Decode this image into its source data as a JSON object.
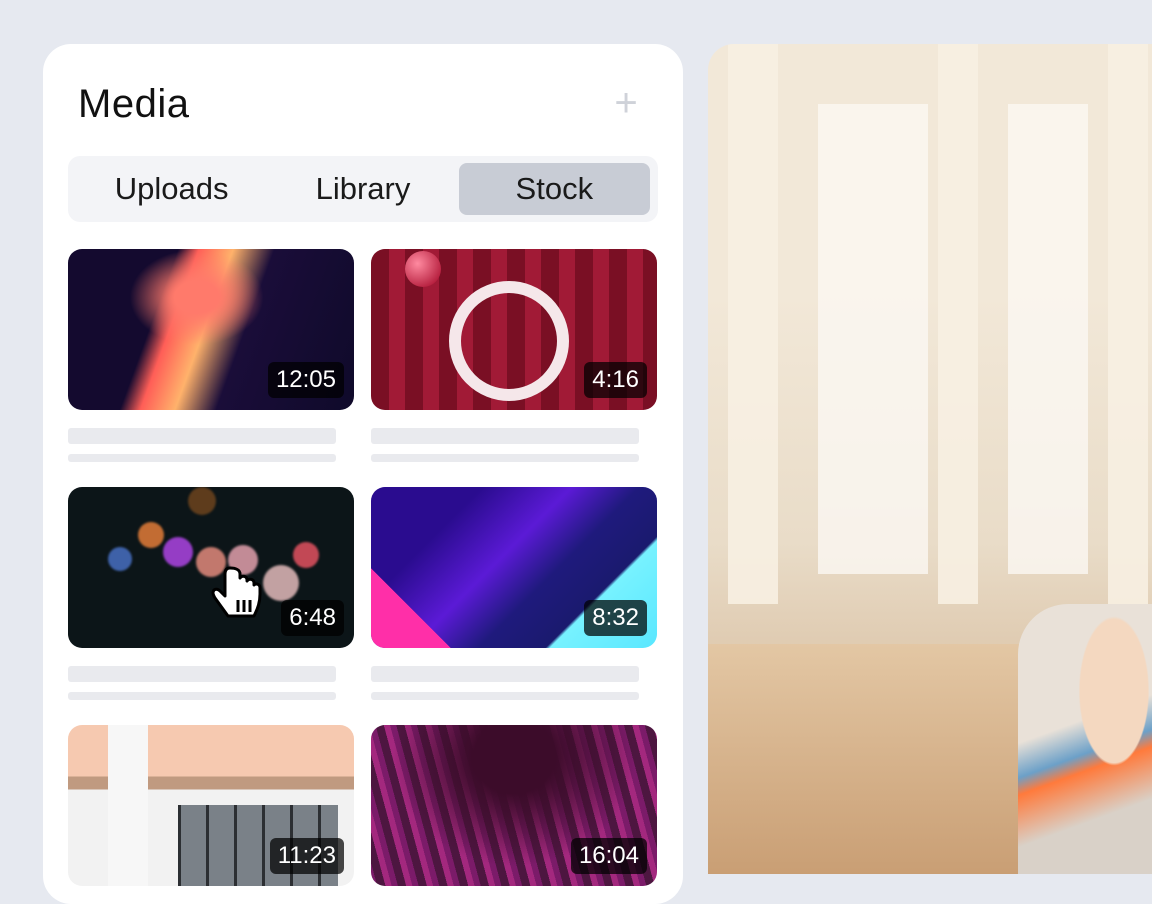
{
  "panel": {
    "title": "Media",
    "add_label": "+",
    "tabs": [
      {
        "label": "Uploads",
        "active": false
      },
      {
        "label": "Library",
        "active": false
      },
      {
        "label": "Stock",
        "active": true
      }
    ]
  },
  "media": [
    {
      "duration": "12:05"
    },
    {
      "duration": "4:16"
    },
    {
      "duration": "6:48"
    },
    {
      "duration": "8:32"
    },
    {
      "duration": "11:23"
    },
    {
      "duration": "16:04"
    }
  ],
  "colors": {
    "background": "#e6e9f0",
    "panel": "#ffffff",
    "active_tab": "#c8ccd5",
    "tab_bar": "#f3f4f7",
    "placeholder": "#e9eaee"
  },
  "icons": {
    "add": "plus-icon",
    "cursor": "hand-pointer-icon"
  }
}
